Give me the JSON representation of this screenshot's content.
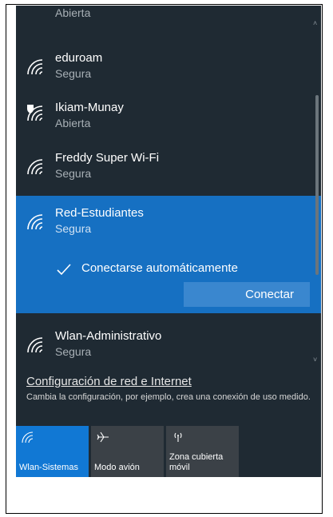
{
  "networks": [
    {
      "name": "",
      "status": "Abierta"
    },
    {
      "name": "eduroam",
      "status": "Segura"
    },
    {
      "name": "Ikiam-Munay",
      "status": "Abierta"
    },
    {
      "name": "Freddy Super Wi-Fi",
      "status": "Segura"
    },
    {
      "name": "Red-Estudiantes",
      "status": "Segura",
      "auto_connect_label": "Conectarse automáticamente",
      "connect_label": "Conectar"
    },
    {
      "name": "Wlan-Administrativo",
      "status": "Segura"
    }
  ],
  "settings": {
    "link_label": "Configuración de red e Internet",
    "description": "Cambia la configuración, por ejemplo, crea una conexión de uso medido."
  },
  "tiles": [
    {
      "label": "Wlan-Sistemas",
      "icon": "wifi-icon"
    },
    {
      "label": "Modo avión",
      "icon": "airplane-icon"
    },
    {
      "label": "Zona cubierta\nmóvil",
      "label_line1": "Zona cubierta",
      "label_line2": "móvil",
      "icon": "hotspot-icon"
    }
  ],
  "colors": {
    "panel_bg": "#1f2a33",
    "selected_bg": "#1670c2",
    "accent": "#1178d4",
    "tile_bg": "#3b4147"
  }
}
